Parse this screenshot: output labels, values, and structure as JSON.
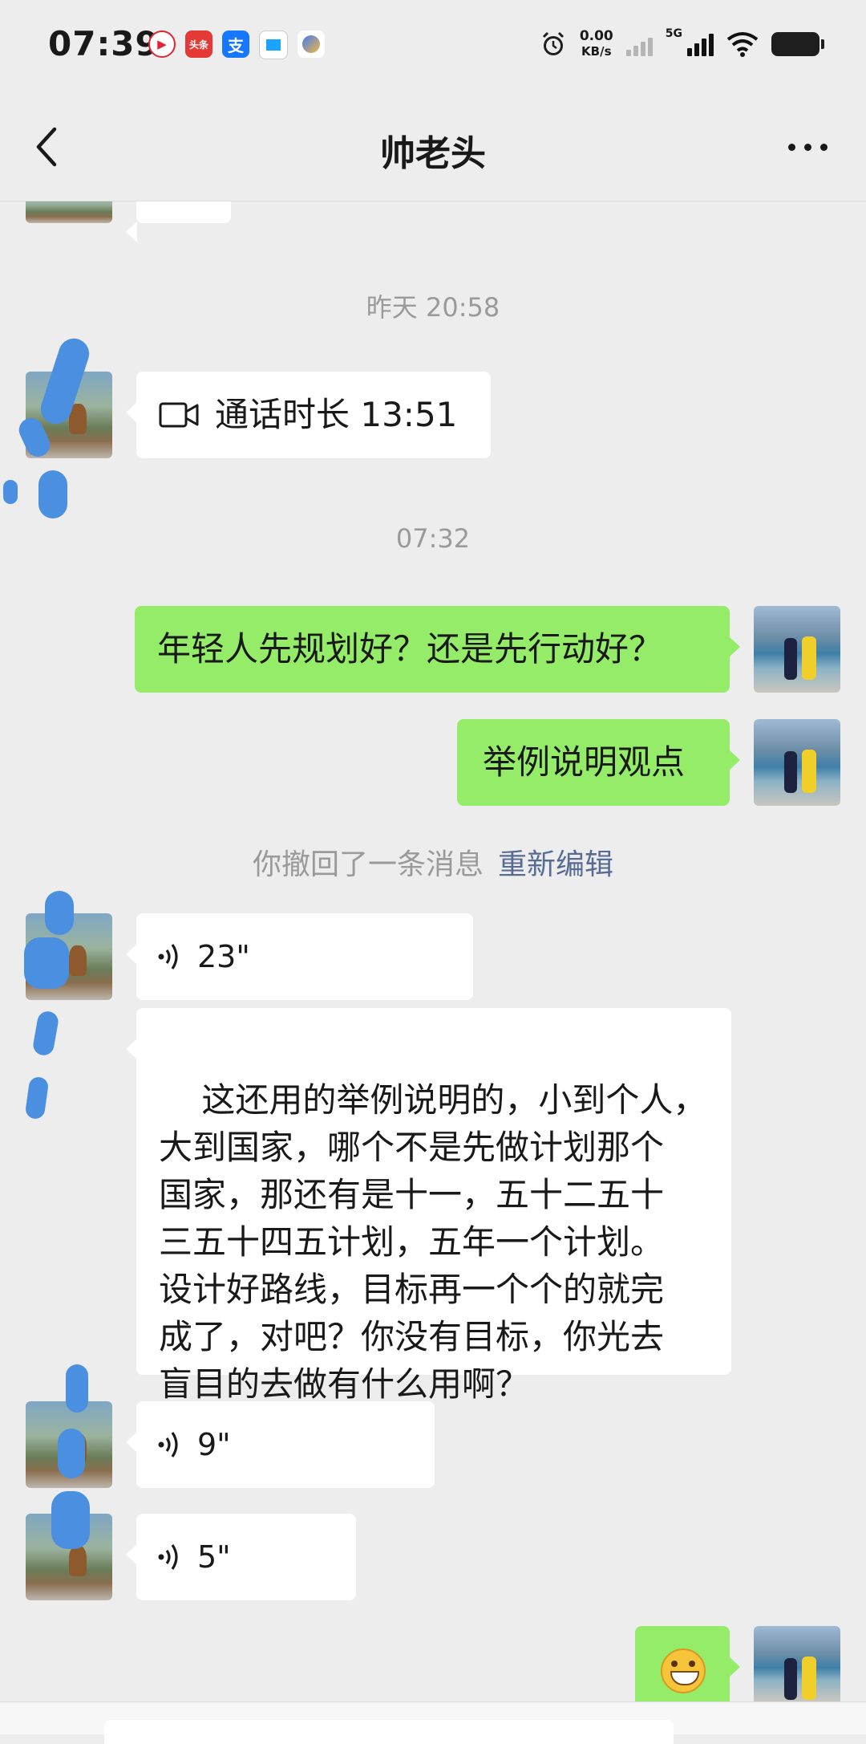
{
  "status_bar": {
    "time": "07:39",
    "app_icons": [
      "red-circle-app-icon",
      "toutiao-app-icon",
      "alipay-app-icon",
      "doc-app-icon",
      "baidu-app-icon"
    ],
    "toutiao_label": "头条",
    "alipay_label": "支",
    "net_speed_value": "0.00",
    "net_speed_unit": "KB/s",
    "network_type": "5G"
  },
  "nav": {
    "title": "帅老头"
  },
  "messages": {
    "time_yesterday": "昨天 20:58",
    "call_text": "通话时长 13:51",
    "time_today": "07:32",
    "sent_1": "年轻人先规划好？还是先行动好？",
    "sent_2": "举例说明观点",
    "recall_text": "你撤回了一条消息",
    "recall_action": "重新编辑",
    "voice_1": "23\"",
    "reply_text": "这还用的举例说明的，小到个人，\n大到国家，哪个不是先做计划那个\n国家，那还有是十一，五十二五十\n三五十四五计划，五年一个计划。\n设计好路线，目标再一个个的就完\n成了，对吧？你没有目标，你光去\n盲目的去做有什么用啊？",
    "voice_2": "9\"",
    "voice_3": "5\"",
    "last_sent_emoji": "grinning-face-icon"
  },
  "colors": {
    "background": "#ededed",
    "sent_bubble": "#95ec69",
    "received_bubble": "#ffffff",
    "link": "#576b95",
    "muted": "#9a9a9a"
  }
}
